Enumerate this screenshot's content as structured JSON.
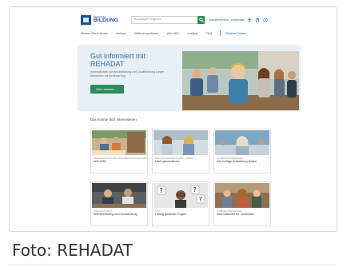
{
  "header": {
    "logo_top": "REHADAT",
    "logo_main": "BILDUNG",
    "search_placeholder": "Suchbegriff eingeben",
    "utility_links": [
      "Barrierefreiheit",
      "Infoportale"
    ]
  },
  "nav": {
    "items": [
      "Meinen Beruf finden",
      "Inklusiv",
      "Maßnahmenfinder",
      "Wer hilft?",
      "Lexikon",
      "FAQ"
    ],
    "special": "Weitere Portale"
  },
  "hero": {
    "title": "Gut informiert mit REHADAT",
    "subtitle": "Informationen zur Berufsbildung und Qualifizierung junger Menschen mit Behinderung",
    "button": "Mehr erfahren →"
  },
  "section": {
    "title": "Das könnte dich interessieren",
    "cards": [
      {
        "category": "ANSPRECHSTELLEN UND BERATUNGSANGEBOTE",
        "title": "Wer hilft?"
      },
      {
        "category": "BILDUNGSMASSNAHMEN FINDEN",
        "title": "Maßnahmenfinder"
      },
      {
        "category": "AUSBILDUNGSBERUFE",
        "title": "Die richtige Ausbildung finden"
      },
      {
        "category": "WIE GEHT DAS?",
        "title": "Wiedereinstieg und Umschulung"
      },
      {
        "category": "FAQ",
        "title": "Häufig gestellte Fragen"
      },
      {
        "category": "AUSBILDUNGSHILFEN",
        "title": "Informationen für Lehrkräfte"
      }
    ]
  },
  "caption": "Foto: REHADAT",
  "colors": {
    "brand": "#1f4e99",
    "accent_green": "#2f8a57",
    "hero_bg": "#e8f0f5",
    "hero_title": "#2a6f9f"
  }
}
